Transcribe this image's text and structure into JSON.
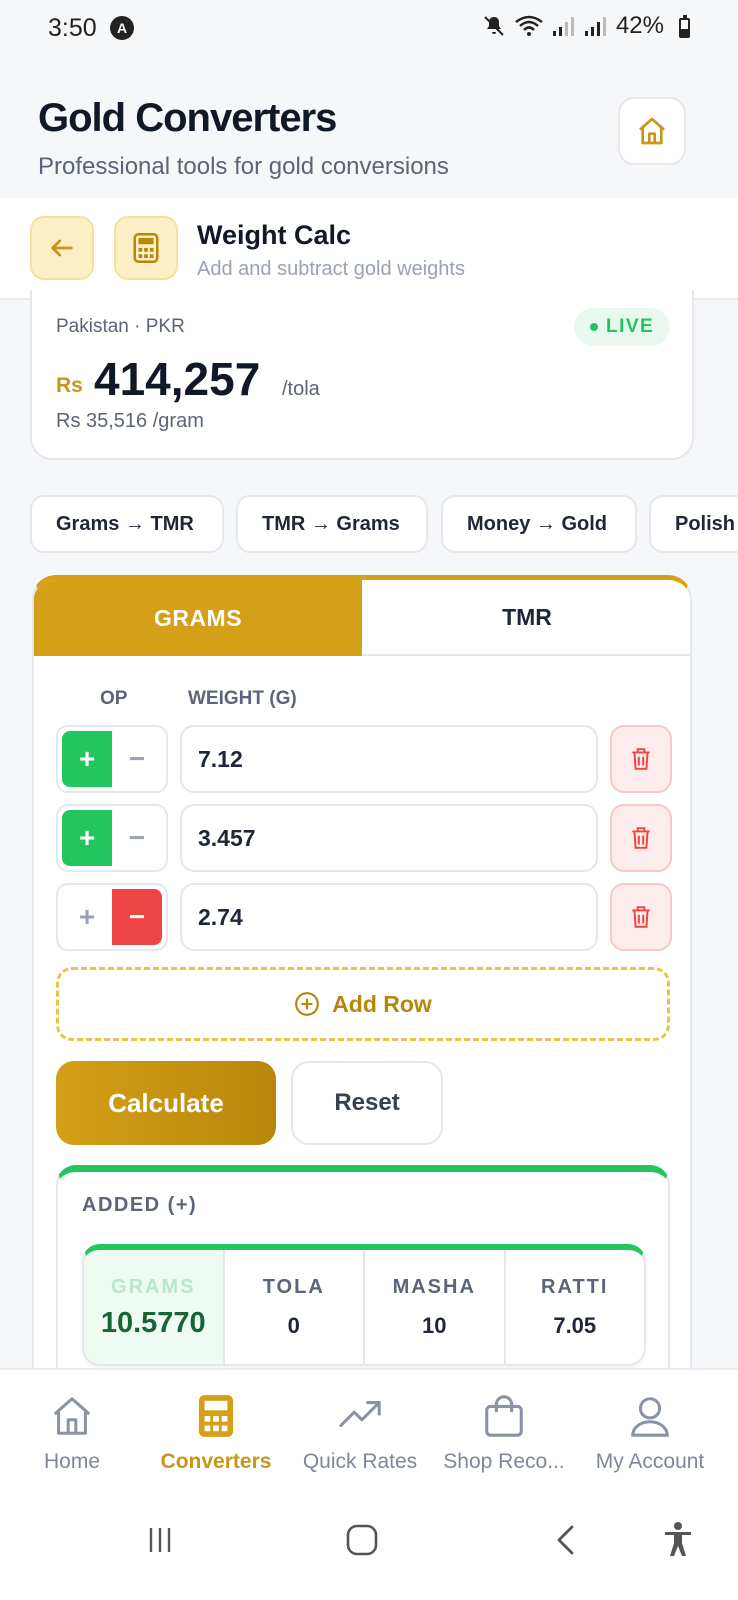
{
  "status_bar": {
    "time": "3:50",
    "notif_badge": "A",
    "battery": "42%"
  },
  "header": {
    "title": "Gold Converters",
    "subtitle": "Professional tools for gold conversions"
  },
  "subheader": {
    "title": "Weight Calc",
    "subtitle": "Add and subtract gold weights"
  },
  "price_card": {
    "country": "Pakistan · PKR",
    "live": "LIVE",
    "currency": "Rs",
    "price": "414,257",
    "unit": "/tola",
    "per_gram": "Rs 35,516 /gram"
  },
  "chips": [
    "Grams → TMR",
    "TMR → Grams",
    "Money → Gold",
    "Polish"
  ],
  "tabs": {
    "active": "GRAMS",
    "other": "TMR"
  },
  "columns": {
    "op": "OP",
    "weight": "WEIGHT (G)"
  },
  "rows": [
    {
      "value": "7.12",
      "op": "plus"
    },
    {
      "value": "3.457",
      "op": "plus"
    },
    {
      "value": "2.74",
      "op": "minus"
    }
  ],
  "op_symbols": {
    "plus": "+",
    "minus": "−"
  },
  "add_row_label": "Add Row",
  "actions": {
    "calculate": "Calculate",
    "reset": "Reset"
  },
  "result": {
    "title": "ADDED (+)",
    "cells": [
      {
        "label": "GRAMS",
        "value": "10.5770"
      },
      {
        "label": "TOLA",
        "value": "0"
      },
      {
        "label": "MASHA",
        "value": "10"
      },
      {
        "label": "RATTI",
        "value": "7.05"
      }
    ]
  },
  "bottom_nav": [
    {
      "label": "Home",
      "icon": "home-icon"
    },
    {
      "label": "Converters",
      "icon": "calculator-icon",
      "active": true
    },
    {
      "label": "Quick Rates",
      "icon": "trending-up-icon"
    },
    {
      "label": "Shop Reco...",
      "icon": "shopping-bag-icon"
    },
    {
      "label": "My Account",
      "icon": "user-icon"
    }
  ],
  "colors": {
    "gold": "#d4a017",
    "green": "#22c55e",
    "red": "#ef4444"
  }
}
